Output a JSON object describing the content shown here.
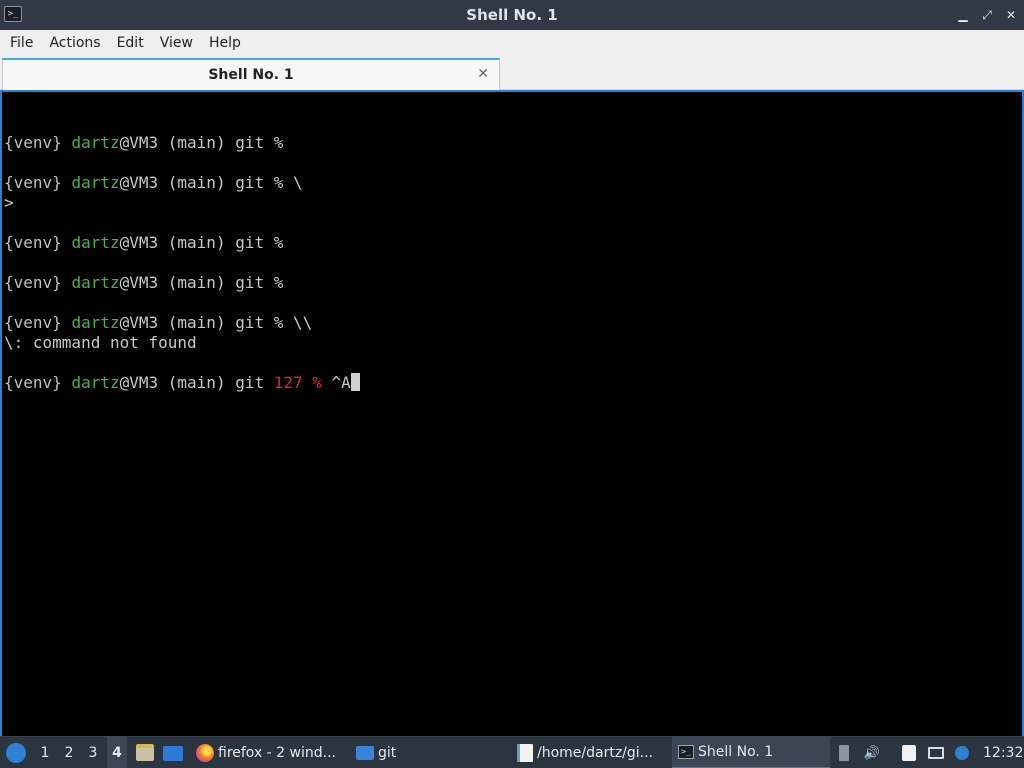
{
  "window": {
    "title": "Shell No. 1",
    "controls": {
      "minimize": "▁",
      "restore": "⤢",
      "close": "✕"
    }
  },
  "menubar": {
    "items": [
      "File",
      "Actions",
      "Edit",
      "View",
      "Help"
    ]
  },
  "tabs": [
    {
      "label": "Shell No. 1",
      "close": "✕"
    }
  ],
  "terminal": {
    "lines": [
      {
        "segments": []
      },
      {
        "segments": [
          {
            "text": "{venv}",
            "color": "gray"
          },
          {
            "text": " "
          },
          {
            "text": "dartz",
            "color": "green"
          },
          {
            "text": "@VM3 (main) git %"
          }
        ]
      },
      {
        "segments": []
      },
      {
        "segments": [
          {
            "text": "{venv}",
            "color": "gray"
          },
          {
            "text": " "
          },
          {
            "text": "dartz",
            "color": "green"
          },
          {
            "text": "@VM3 (main) git % \\"
          }
        ]
      },
      {
        "segments": [
          {
            "text": ">"
          }
        ]
      },
      {
        "segments": []
      },
      {
        "segments": [
          {
            "text": "{venv}",
            "color": "gray"
          },
          {
            "text": " "
          },
          {
            "text": "dartz",
            "color": "green"
          },
          {
            "text": "@VM3 (main) git %"
          }
        ]
      },
      {
        "segments": []
      },
      {
        "segments": [
          {
            "text": "{venv}",
            "color": "gray"
          },
          {
            "text": " "
          },
          {
            "text": "dartz",
            "color": "green"
          },
          {
            "text": "@VM3 (main) git %"
          }
        ]
      },
      {
        "segments": []
      },
      {
        "segments": [
          {
            "text": "{venv}",
            "color": "gray"
          },
          {
            "text": " "
          },
          {
            "text": "dartz",
            "color": "green"
          },
          {
            "text": "@VM3 (main) git % \\\\"
          }
        ]
      },
      {
        "segments": [
          {
            "text": "\\: command not found"
          }
        ]
      },
      {
        "segments": []
      },
      {
        "segments": [
          {
            "text": "{venv}",
            "color": "gray"
          },
          {
            "text": " "
          },
          {
            "text": "dartz",
            "color": "green"
          },
          {
            "text": "@VM3 (main) git "
          },
          {
            "text": "127 %",
            "color": "red"
          },
          {
            "text": " ^A"
          }
        ],
        "cursor": true
      }
    ],
    "colors": {
      "green": "#4caf50",
      "red": "#d62b2b",
      "gray": "#c0c0c0",
      "background": "#000000"
    }
  },
  "taskbar": {
    "workspaces": [
      "1",
      "2",
      "3",
      "4"
    ],
    "active_workspace": "4",
    "tasks": [
      {
        "label": "firefox - 2 wind...",
        "icon": "firefox-icon"
      },
      {
        "label": "git",
        "icon": "folder-icon"
      },
      {
        "label": "/home/dartz/gi...",
        "icon": "text-editor-icon"
      },
      {
        "label": "Shell No. 1",
        "icon": "terminal-icon",
        "active": true
      }
    ],
    "clock": "12:32"
  }
}
